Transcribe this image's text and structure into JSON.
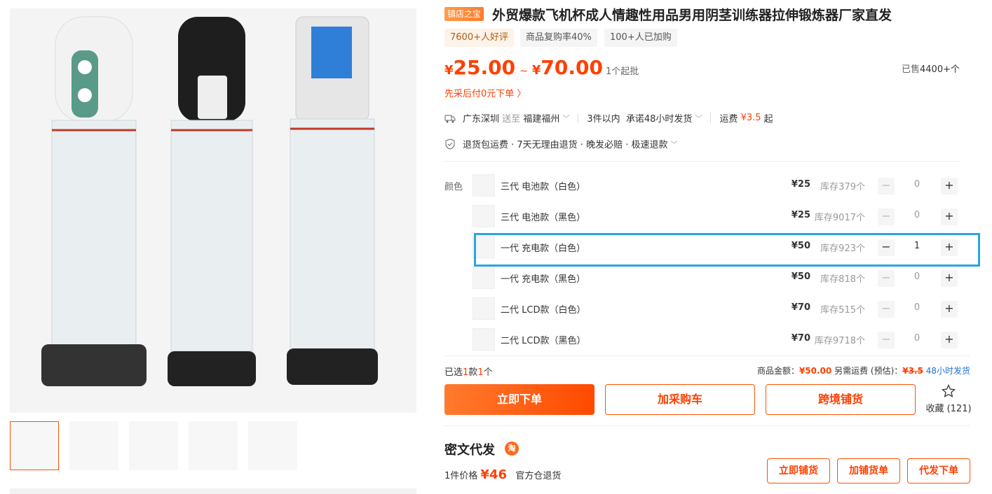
{
  "title": {
    "badge": "镇店之宝",
    "text": "外贸爆款飞机杯成人情趣性用品男用阴茎训练器拉伸锻炼器厂家直发"
  },
  "tags": [
    "7600+人好评",
    "商品复购率40%",
    "100+人已加购"
  ],
  "price": {
    "currency": "¥",
    "low": "25.00",
    "tilde": "~",
    "high": "70.00",
    "min_order": "1个起批"
  },
  "sold": {
    "prefix": "已售",
    "count": "4400+个"
  },
  "pay_later": "先采后付0元下单 〉",
  "shipping": {
    "origin": "广东深圳",
    "to_label": "送至",
    "destination": "福建福州",
    "promise_qty": "3件以内",
    "promise_text": "承诺48小时发货",
    "fee_label": "运费",
    "fee": "¥3.5",
    "fee_suffix": "起"
  },
  "services": "退货包运费 · 7天无理由退货 · 晚发必赔 · 极速退款",
  "sku": {
    "label": "颜色",
    "items": [
      {
        "name": "三代 电池款（白色）",
        "price": "¥25",
        "stock": "库存379个",
        "qty": "0"
      },
      {
        "name": "三代 电池款（黑色）",
        "price": "¥25",
        "stock": "库存9017个",
        "qty": "0"
      },
      {
        "name": "一代 充电款（白色）",
        "price": "¥50",
        "stock": "库存923个",
        "qty": "1"
      },
      {
        "name": "一代 充电款（黑色）",
        "price": "¥50",
        "stock": "库存818个",
        "qty": "0"
      },
      {
        "name": "二代 LCD款（白色）",
        "price": "¥70",
        "stock": "库存515个",
        "qty": "0"
      },
      {
        "name": "二代 LCD款（黑色）",
        "price": "¥70",
        "stock": "库存9718个",
        "qty": "0"
      }
    ],
    "minus": "−",
    "plus": "+"
  },
  "summary": {
    "selected_prefix": "已选",
    "selected_kinds": "1",
    "kinds_unit": "款",
    "selected_count": "1",
    "count_unit": "个",
    "amount_label": "商品金额：",
    "amount": "¥50.00",
    "extra_label": "另需运费 (预估)：",
    "extra": "¥3.5",
    "ship_time": "48小时发货"
  },
  "actions": {
    "order": "立即下单",
    "cart": "加采购车",
    "cross": "跨境铺货",
    "fav_label": "收藏",
    "fav_count": "(121)"
  },
  "dropship": {
    "title": "密文代发",
    "tao": "淘",
    "one_price_label": "1件价格",
    "one_price": "¥46",
    "official": "官方仓退货",
    "btn_dist": "立即铺货",
    "btn_add": "加铺货单",
    "btn_order": "代发下单"
  },
  "colors": {
    "accent": "#ff4000",
    "highlight": "#2aa5e0",
    "link": "#2273d7"
  }
}
